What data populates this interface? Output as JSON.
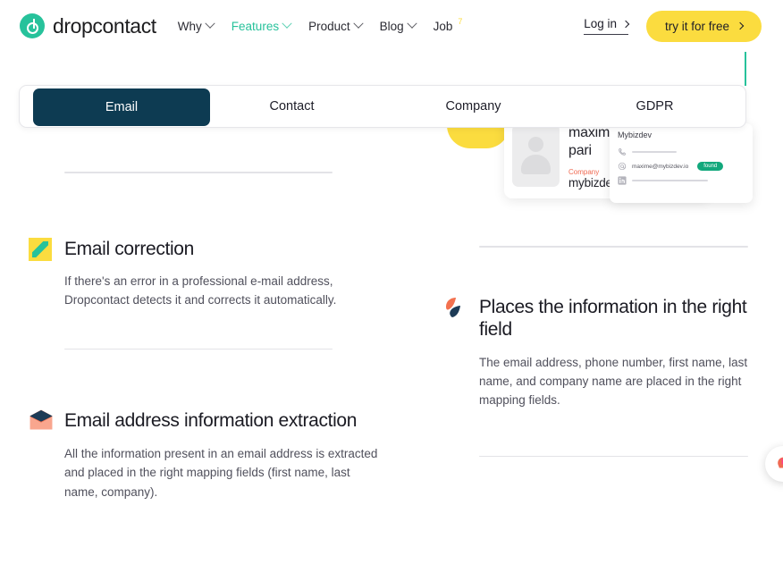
{
  "header": {
    "brand": "dropcontact",
    "logo_icon": "dropcontact-logo-icon",
    "nav": [
      {
        "label": "Why",
        "has_caret": true,
        "active": false
      },
      {
        "label": "Features",
        "has_caret": true,
        "active": true
      },
      {
        "label": "Product",
        "has_caret": true,
        "active": false
      },
      {
        "label": "Blog",
        "has_caret": true,
        "active": false
      },
      {
        "label": "Job",
        "has_caret": false,
        "active": false,
        "superscript": "7"
      }
    ],
    "login_label": "Log in",
    "cta_label": "try it for free"
  },
  "tabs": {
    "items": [
      {
        "label": "Email",
        "active": true
      },
      {
        "label": "Contact",
        "active": false
      },
      {
        "label": "Company",
        "active": false
      },
      {
        "label": "GDPR",
        "active": false
      }
    ]
  },
  "contact_card": {
    "name_line1": "maxim",
    "name_line2": "pari",
    "company_label": "Company",
    "company_value": "mybizdev",
    "detail": {
      "title": "Mybizdev",
      "phone_icon": "phone-icon",
      "email_icon": "at-icon",
      "linkedin_icon": "linkedin-icon",
      "email": "maxime@mybizdev.io",
      "badge": "found"
    }
  },
  "features_left": [
    {
      "icon": "pencil-icon",
      "title": "Email correction",
      "desc": "If there's an error in a professional e-mail address, Dropcontact detects it and corrects it automatically."
    },
    {
      "icon": "envelope-icon",
      "title": "Email address information extraction",
      "desc": "All the information present in an email address is extracted and placed in the right mapping fields (first name, last name, company)."
    }
  ],
  "features_right": [
    {
      "icon": "leaves-icon",
      "title": "Places the information in the right field",
      "desc": "The email address, phone number, first name, last name, and company name are placed in the right mapping fields."
    }
  ],
  "widget": {
    "icon": "chat-widget-icon"
  },
  "colors": {
    "brand_green": "#27c29b",
    "accent_yellow": "#fbdc3f",
    "navy": "#0d3b52",
    "orange": "#f06a52",
    "badge_green": "#12a87c"
  }
}
